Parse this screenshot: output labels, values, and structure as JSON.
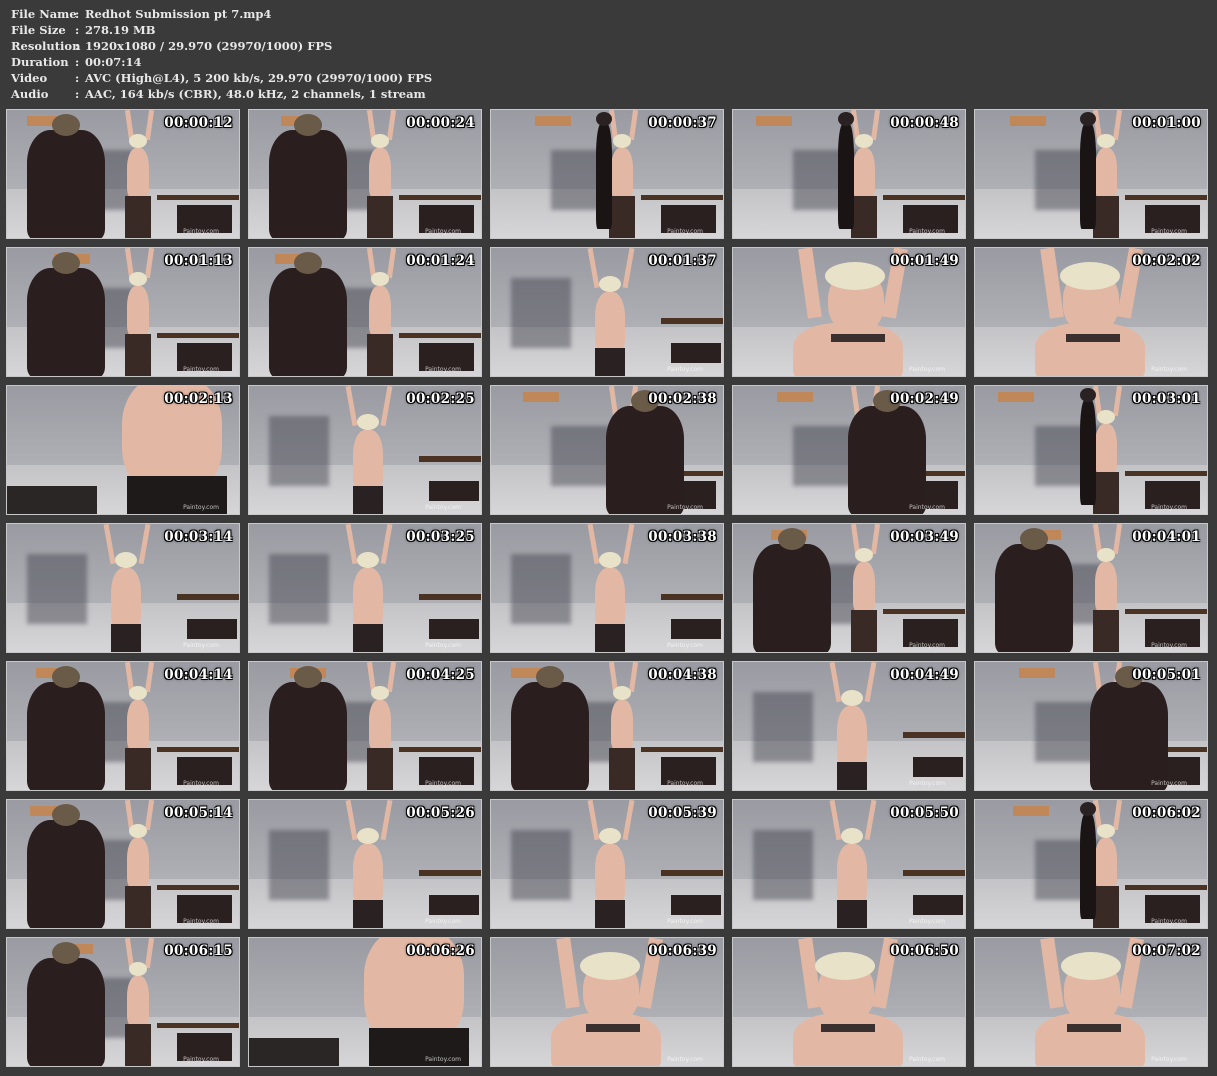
{
  "info": [
    {
      "key": "File Name",
      "value": "Redhot Submission pt 7.mp4"
    },
    {
      "key": "File Size",
      "value": "278.19 MB"
    },
    {
      "key": "Resolution",
      "value": "1920x1080 / 29.970 (29970/1000) FPS"
    },
    {
      "key": "Duration",
      "value": "00:07:14"
    },
    {
      "key": "Video",
      "value": "AVC (High@L4), 5 200 kb/s, 29.970 (29970/1000) FPS"
    },
    {
      "key": "Audio",
      "value": "AAC, 164 kb/s (CBR), 48.0 kHz, 2 channels, 1 stream"
    }
  ],
  "separator": ":",
  "watermark": "Paintoy.com",
  "colors": {
    "background": "#3a3a3a",
    "text": "#e8e8e8",
    "timestamp": "#ffffff",
    "border": "#c8c8c8"
  },
  "thumbnails": [
    {
      "time": "00:00:12",
      "scene": "wide-man-left"
    },
    {
      "time": "00:00:24",
      "scene": "wide-man-left"
    },
    {
      "time": "00:00:37",
      "scene": "wide-two"
    },
    {
      "time": "00:00:48",
      "scene": "wide-two"
    },
    {
      "time": "00:01:00",
      "scene": "wide-two"
    },
    {
      "time": "00:01:13",
      "scene": "wide-man-left"
    },
    {
      "time": "00:01:24",
      "scene": "wide-man-left"
    },
    {
      "time": "00:01:37",
      "scene": "medium-woman"
    },
    {
      "time": "00:01:49",
      "scene": "closeup-face"
    },
    {
      "time": "00:02:02",
      "scene": "closeup-face"
    },
    {
      "time": "00:02:13",
      "scene": "closeup-torso"
    },
    {
      "time": "00:02:25",
      "scene": "medium-woman"
    },
    {
      "time": "00:02:38",
      "scene": "wide-man-center"
    },
    {
      "time": "00:02:49",
      "scene": "wide-man-center"
    },
    {
      "time": "00:03:01",
      "scene": "wide-two"
    },
    {
      "time": "00:03:14",
      "scene": "medium-woman"
    },
    {
      "time": "00:03:25",
      "scene": "medium-woman"
    },
    {
      "time": "00:03:38",
      "scene": "medium-woman"
    },
    {
      "time": "00:03:49",
      "scene": "wide-man-left"
    },
    {
      "time": "00:04:01",
      "scene": "wide-man-left"
    },
    {
      "time": "00:04:14",
      "scene": "wide-man-left"
    },
    {
      "time": "00:04:25",
      "scene": "wide-man-left"
    },
    {
      "time": "00:04:38",
      "scene": "wide-man-left"
    },
    {
      "time": "00:04:49",
      "scene": "medium-woman"
    },
    {
      "time": "00:05:01",
      "scene": "wide-man-center"
    },
    {
      "time": "00:05:14",
      "scene": "wide-man-left"
    },
    {
      "time": "00:05:26",
      "scene": "medium-woman"
    },
    {
      "time": "00:05:39",
      "scene": "medium-woman"
    },
    {
      "time": "00:05:50",
      "scene": "medium-woman"
    },
    {
      "time": "00:06:02",
      "scene": "wide-two"
    },
    {
      "time": "00:06:15",
      "scene": "wide-man-left"
    },
    {
      "time": "00:06:26",
      "scene": "closeup-torso"
    },
    {
      "time": "00:06:39",
      "scene": "closeup-face"
    },
    {
      "time": "00:06:50",
      "scene": "closeup-face"
    },
    {
      "time": "00:07:02",
      "scene": "closeup-face"
    }
  ]
}
